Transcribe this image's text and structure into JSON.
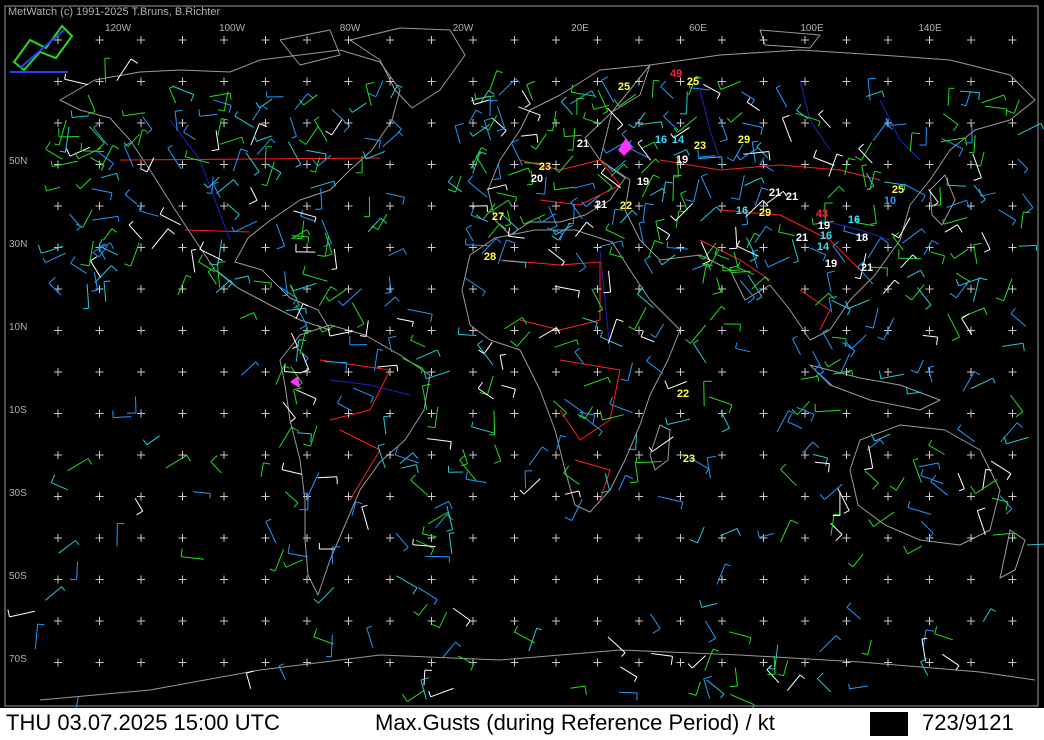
{
  "app": {
    "copyright": "MetWatch  (c) 1991-2025 T.Bruns, B.Richter",
    "logo_icon": "metwatch-logo-icon"
  },
  "status_bar": {
    "datetime": "THU 03.07.2025 15:00 UTC",
    "title": "Max.Gusts (during Reference Period) / kt",
    "count": "723/9121"
  },
  "colors": {
    "coastline": "#9a9a9a",
    "border": "#ff2020",
    "river": "#2020c0",
    "grid": "#c8c8c8",
    "barb_green": "#22dd22",
    "barb_blue": "#2299ff",
    "barb_cyan": "#22ccdd",
    "barb_white": "#ffffff",
    "barb_yellow": "#ffee22",
    "gust_yellow": "#ffff40",
    "gust_white": "#ffffff",
    "gust_cyan": "#30e0ff",
    "gust_red": "#ff2040",
    "gust_magenta": "#ff33ff"
  },
  "graticule": {
    "lon_labels": [
      "120W",
      "100W",
      "80W",
      "20W",
      "20E",
      "60E",
      "100E",
      "140E"
    ],
    "lat_labels": [
      "50N",
      "30N",
      "10N",
      "10S",
      "30S",
      "50S",
      "70S"
    ]
  },
  "gust_labels": [
    {
      "value": "49",
      "color": "red"
    },
    {
      "value": "25",
      "color": "yellow"
    },
    {
      "value": "25",
      "color": "yellow"
    },
    {
      "value": "21",
      "color": "white"
    },
    {
      "value": "16",
      "color": "cyan"
    },
    {
      "value": "14",
      "color": "cyan"
    },
    {
      "value": "23",
      "color": "yellow"
    },
    {
      "value": "29",
      "color": "yellow"
    },
    {
      "value": "19",
      "color": "white"
    },
    {
      "value": "23",
      "color": "yellow"
    },
    {
      "value": "20",
      "color": "white"
    },
    {
      "value": "19",
      "color": "white"
    },
    {
      "value": "21",
      "color": "white"
    },
    {
      "value": "21",
      "color": "white"
    },
    {
      "value": "25",
      "color": "yellow"
    },
    {
      "value": "10",
      "color": "blue"
    },
    {
      "value": "21",
      "color": "white"
    },
    {
      "value": "22",
      "color": "yellow"
    },
    {
      "value": "27",
      "color": "yellow"
    },
    {
      "value": "16",
      "color": "cyan"
    },
    {
      "value": "29",
      "color": "yellow"
    },
    {
      "value": "43",
      "color": "red"
    },
    {
      "value": "19",
      "color": "white"
    },
    {
      "value": "16",
      "color": "cyan"
    },
    {
      "value": "21",
      "color": "white"
    },
    {
      "value": "16",
      "color": "cyan"
    },
    {
      "value": "18",
      "color": "white"
    },
    {
      "value": "14",
      "color": "cyan"
    },
    {
      "value": "28",
      "color": "yellow"
    },
    {
      "value": "19",
      "color": "white"
    },
    {
      "value": "21",
      "color": "white"
    },
    {
      "value": "22",
      "color": "yellow"
    },
    {
      "value": "23",
      "color": "yellow"
    }
  ]
}
